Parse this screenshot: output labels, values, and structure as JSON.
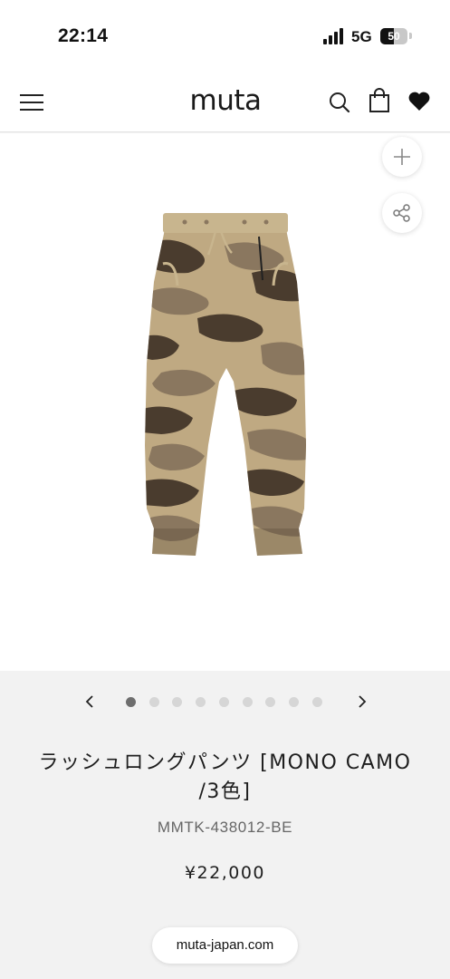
{
  "status_bar": {
    "time": "22:14",
    "network": "5G",
    "battery_percent": 50,
    "battery_label": "50"
  },
  "header": {
    "logo": "muta",
    "icons": [
      "menu-icon",
      "search-icon",
      "shopping-bag-icon",
      "heart-icon"
    ]
  },
  "hero": {
    "product_image": "camo-jogger-pants",
    "buttons": [
      "plus-icon",
      "share-icon"
    ]
  },
  "carousel": {
    "total_slides": 9,
    "active_index": 0
  },
  "product": {
    "title_line1": "ラッシュロングパンツ [MONO CAMO",
    "title_line2": "/3色]",
    "sku": "MMTK-438012-BE",
    "price": "¥22,000"
  },
  "browser": {
    "url": "muta-japan.com"
  },
  "colors": {
    "background": "#f2f2f2",
    "camo_khaki": "#bfa982",
    "camo_dark": "#4a3c2e",
    "camo_brown": "#8a775f",
    "waistband": "#c8b58e"
  }
}
